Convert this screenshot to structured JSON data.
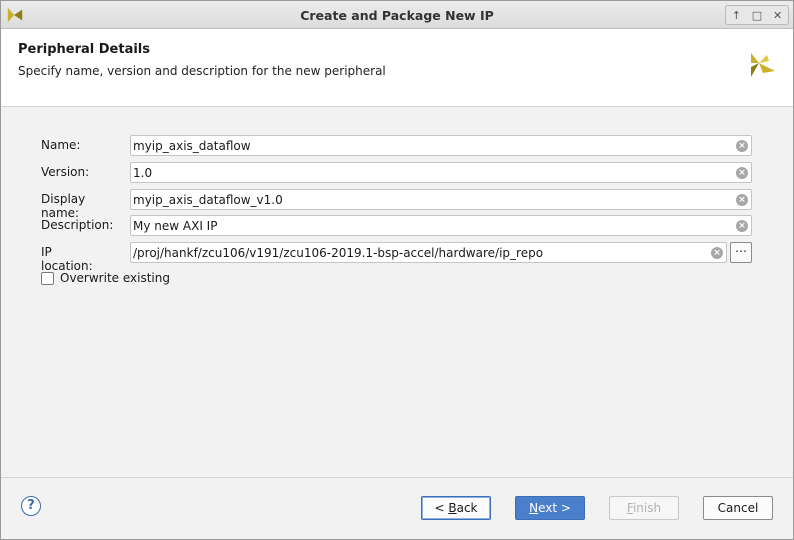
{
  "window": {
    "title": "Create and Package New IP",
    "controls": [
      "↑",
      "□",
      "✕"
    ]
  },
  "header": {
    "title": "Peripheral Details",
    "subtitle": "Specify name, version and description for the new peripheral"
  },
  "form": {
    "name": {
      "label": "Name:",
      "value": "myip_axis_dataflow"
    },
    "version": {
      "label": "Version:",
      "value": "1.0"
    },
    "display_name": {
      "label": "Display name:",
      "value": "myip_axis_dataflow_v1.0"
    },
    "description": {
      "label": "Description:",
      "value": "My new AXI IP"
    },
    "ip_location": {
      "label": "IP location:",
      "value": "/proj/hankf/zcu106/v191/zcu106-2019.1-bsp-accel/hardware/ip_repo",
      "browse_label": "⋯"
    },
    "overwrite": {
      "label": "Overwrite existing",
      "checked": false
    }
  },
  "footer": {
    "help_label": "?",
    "back": {
      "prefix": "< ",
      "mnemonic": "B",
      "rest": "ack"
    },
    "next": {
      "mnemonic": "N",
      "rest": "ext >"
    },
    "finish": {
      "mnemonic": "F",
      "rest": "inish"
    },
    "cancel": "Cancel"
  },
  "colors": {
    "accent": "#4a7fcb",
    "logo": "#c9b22a"
  }
}
